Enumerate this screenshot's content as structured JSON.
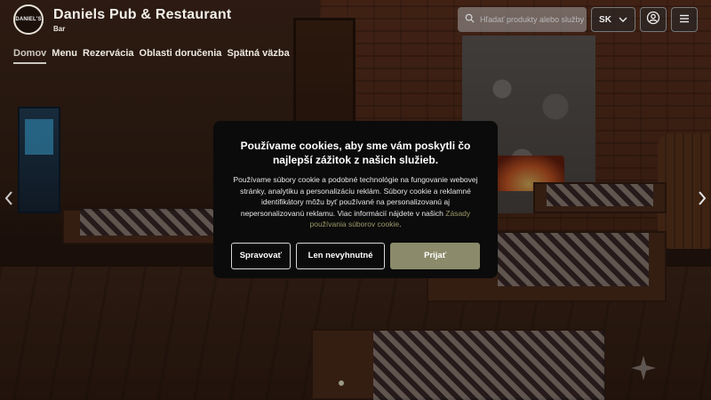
{
  "brand": {
    "title": "Daniels Pub & Restaurant",
    "subtitle": "Bar",
    "logo_text": "DANIEL'S"
  },
  "search": {
    "placeholder": "Hľadať produkty alebo služby",
    "icon": "search-icon"
  },
  "language": {
    "selected": "SK",
    "icon": "chevron-down-icon"
  },
  "header_buttons": {
    "user_icon": "user-icon",
    "menu_icon": "hamburger-menu-icon"
  },
  "nav": {
    "items": [
      {
        "label": "Domov",
        "active": true
      },
      {
        "label": "Menu",
        "active": false
      },
      {
        "label": "Rezervácia",
        "active": false
      },
      {
        "label": "Oblasti doručenia",
        "active": false
      },
      {
        "label": "Spätná väzba",
        "active": false
      }
    ]
  },
  "carousel": {
    "prev_icon": "chevron-left-icon",
    "next_icon": "chevron-right-icon"
  },
  "cookie_modal": {
    "title": "Používame cookies, aby sme vám poskytli čo najlepší zážitok z našich služieb.",
    "body": "Používame súbory cookie a podobné technológie na fungovanie webovej stránky, analytiku a personalizáciu reklám. Súbory cookie a reklamné identifikátory môžu byť používané na personalizovanú aj nepersonalizovanú reklamu. Viac informácií nájdete v našich",
    "link_text": "Zásady používania súborov cookie",
    "link_suffix": ".",
    "buttons": {
      "manage": "Spravovať",
      "necessary": "Len nevyhnutné",
      "accept": "Prijať"
    },
    "accent_color": "#8b8a6a"
  }
}
